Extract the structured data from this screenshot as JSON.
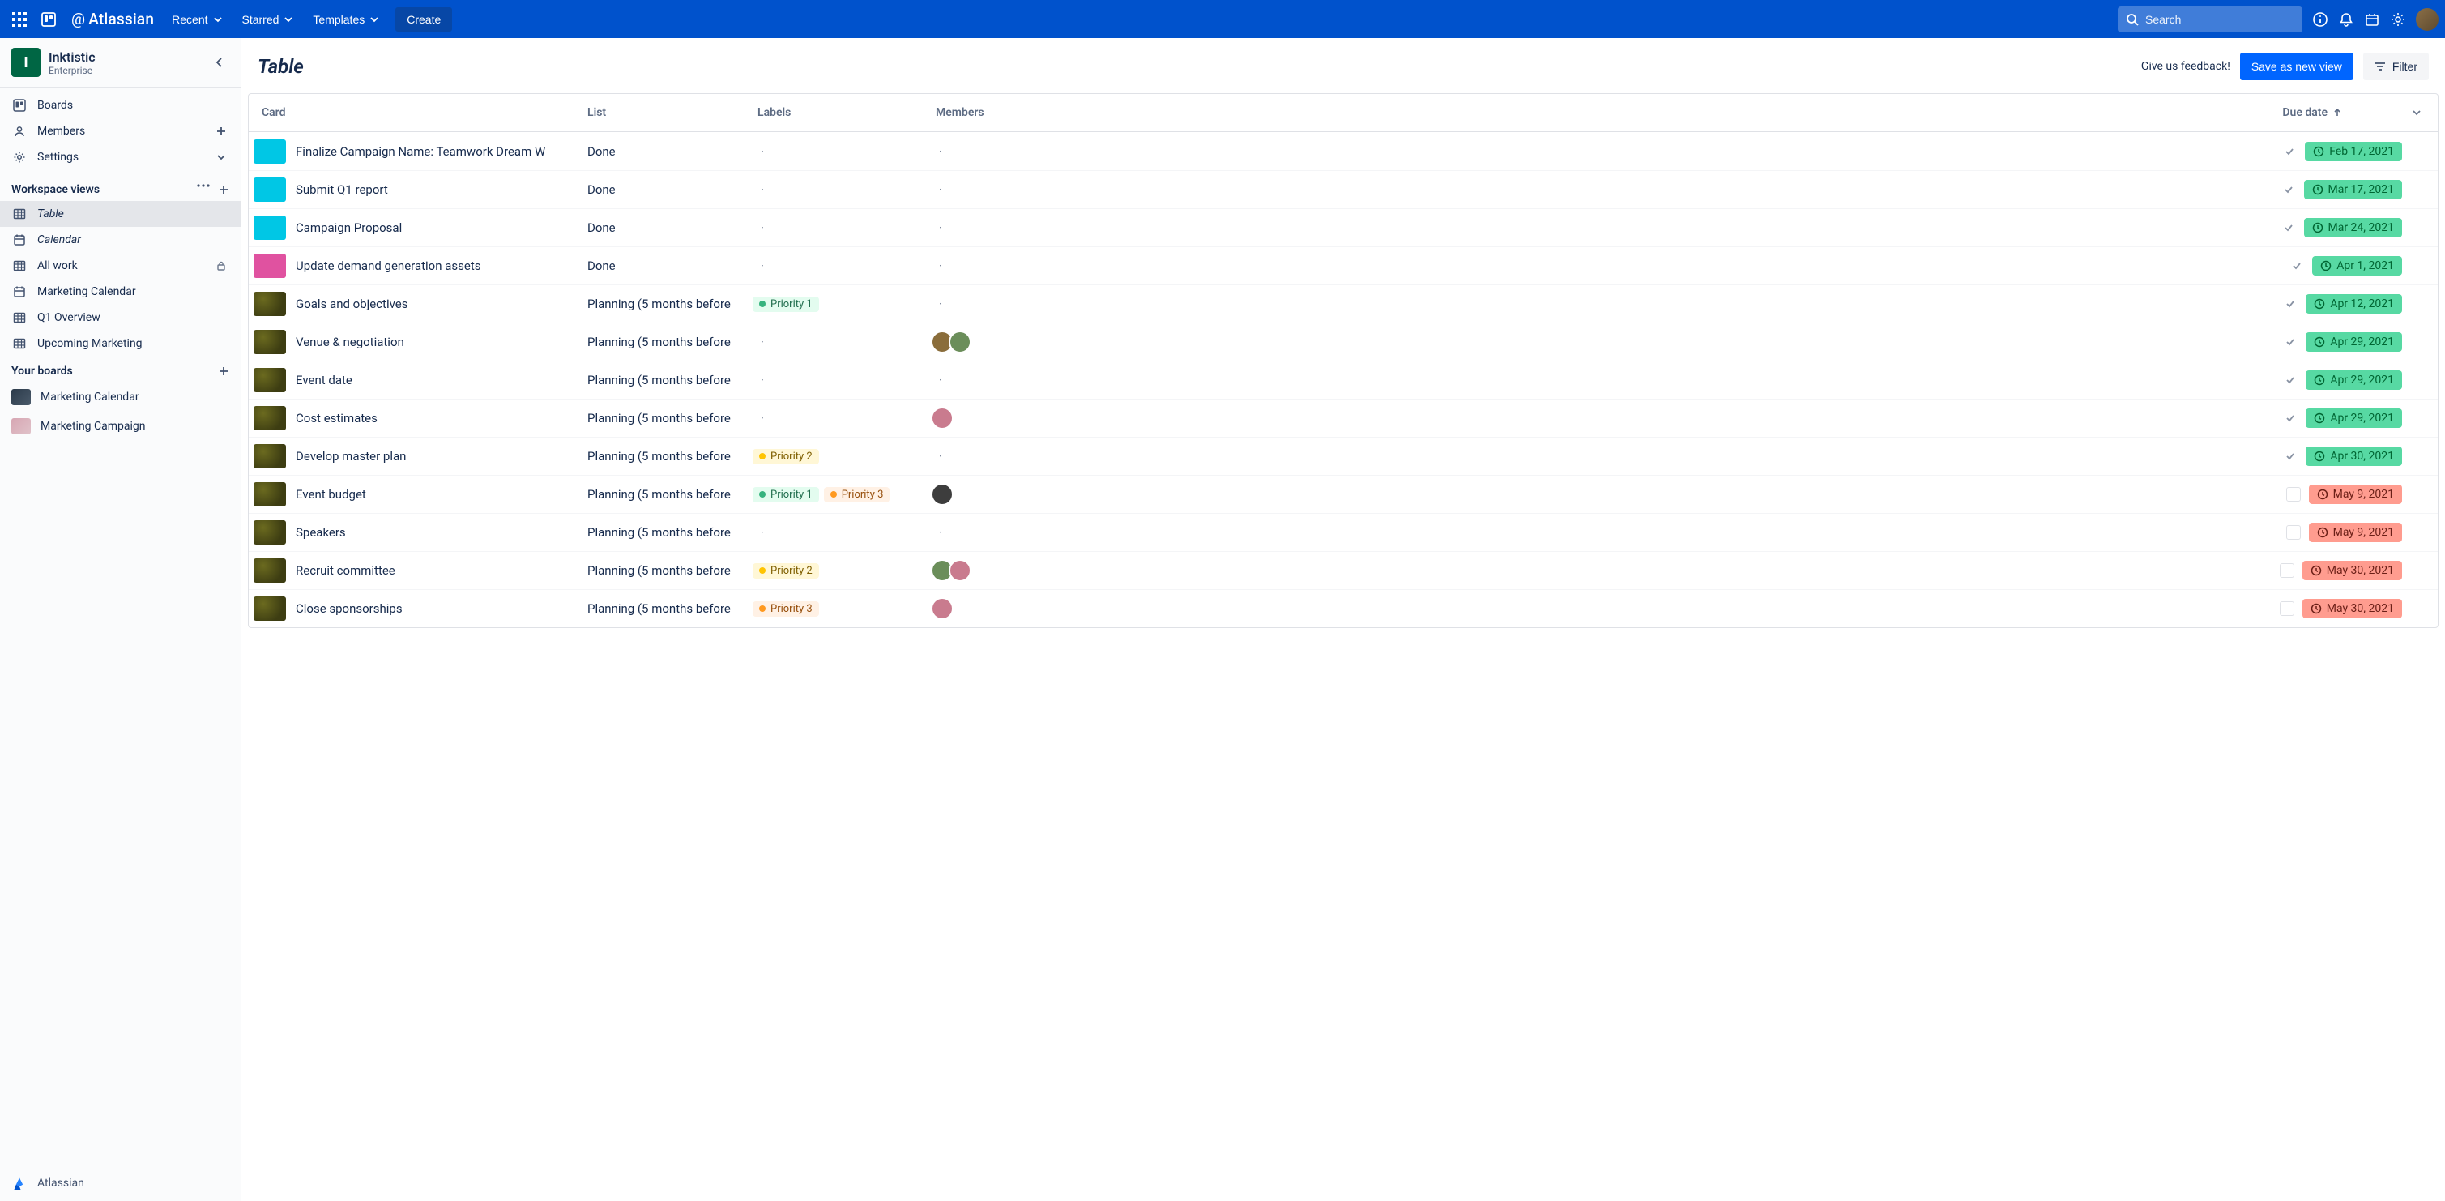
{
  "topnav": {
    "brand": "Atlassian",
    "menus": {
      "recent": "Recent",
      "starred": "Starred",
      "templates": "Templates"
    },
    "create": "Create",
    "search_placeholder": "Search"
  },
  "workspace": {
    "initial": "I",
    "name": "Inktistic",
    "tier": "Enterprise"
  },
  "sidebar": {
    "primary": {
      "boards": "Boards",
      "members": "Members",
      "settings": "Settings"
    },
    "views_heading": "Workspace views",
    "views": [
      {
        "label": "Table",
        "icon": "table",
        "italic": true,
        "active": true
      },
      {
        "label": "Calendar",
        "icon": "calendar",
        "italic": true
      },
      {
        "label": "All work",
        "icon": "table",
        "locked": true
      },
      {
        "label": "Marketing Calendar",
        "icon": "calendar"
      },
      {
        "label": "Q1 Overview",
        "icon": "table"
      },
      {
        "label": "Upcoming Marketing",
        "icon": "table"
      }
    ],
    "boards_heading": "Your boards",
    "boards": [
      {
        "label": "Marketing Calendar",
        "thumb": "dark"
      },
      {
        "label": "Marketing Campaign",
        "thumb": "pink"
      }
    ],
    "footer": "Atlassian"
  },
  "page": {
    "title": "Table",
    "feedback": "Give us feedback!",
    "save": "Save as new view",
    "filter": "Filter"
  },
  "table": {
    "columns": {
      "card": "Card",
      "list": "List",
      "labels": "Labels",
      "members": "Members",
      "due": "Due date"
    },
    "rows": [
      {
        "cover": "cyan",
        "title": "Finalize Campaign Name: Teamwork Dream W",
        "list": "Done",
        "labels": [],
        "members": 0,
        "due": "Feb 17, 2021",
        "due_color": "green",
        "checked": true
      },
      {
        "cover": "cyan",
        "title": "Submit Q1 report",
        "list": "Done",
        "labels": [],
        "members": 0,
        "due": "Mar 17, 2021",
        "due_color": "green",
        "checked": true
      },
      {
        "cover": "cyan",
        "title": "Campaign Proposal",
        "list": "Done",
        "labels": [],
        "members": 0,
        "due": "Mar 24, 2021",
        "due_color": "green",
        "checked": true
      },
      {
        "cover": "pink",
        "title": "Update demand generation assets",
        "list": "Done",
        "labels": [],
        "members": 0,
        "due": "Apr 1, 2021",
        "due_color": "green",
        "checked": true
      },
      {
        "cover": "tex",
        "title": "Goals and objectives",
        "list": "Planning (5 months before",
        "labels": [
          {
            "text": "Priority 1",
            "color": "green"
          }
        ],
        "members": 0,
        "due": "Apr 12, 2021",
        "due_color": "green",
        "checked": true
      },
      {
        "cover": "tex",
        "title": "Venue & negotiation",
        "list": "Planning (5 months before",
        "labels": [],
        "members": 2,
        "due": "Apr 29, 2021",
        "due_color": "green",
        "checked": true
      },
      {
        "cover": "tex",
        "title": "Event date",
        "list": "Planning (5 months before",
        "labels": [],
        "members": 0,
        "due": "Apr 29, 2021",
        "due_color": "green",
        "checked": true
      },
      {
        "cover": "tex",
        "title": "Cost estimates",
        "list": "Planning (5 months before",
        "labels": [],
        "members": 1,
        "due": "Apr 29, 2021",
        "due_color": "green",
        "checked": true
      },
      {
        "cover": "tex",
        "title": "Develop master plan",
        "list": "Planning (5 months before",
        "labels": [
          {
            "text": "Priority 2",
            "color": "yellow"
          }
        ],
        "members": 0,
        "due": "Apr 30, 2021",
        "due_color": "green",
        "checked": true
      },
      {
        "cover": "tex",
        "title": "Event budget",
        "list": "Planning (5 months before",
        "labels": [
          {
            "text": "Priority 1",
            "color": "green"
          },
          {
            "text": "Priority 3",
            "color": "orange"
          }
        ],
        "members": 1,
        "due": "May 9, 2021",
        "due_color": "red",
        "checked": false
      },
      {
        "cover": "tex",
        "title": "Speakers",
        "list": "Planning (5 months before",
        "labels": [],
        "members": 0,
        "due": "May 9, 2021",
        "due_color": "red",
        "checked": false
      },
      {
        "cover": "tex",
        "title": "Recruit committee",
        "list": "Planning (5 months before",
        "labels": [
          {
            "text": "Priority 2",
            "color": "yellow"
          }
        ],
        "members": 2,
        "due": "May 30, 2021",
        "due_color": "red",
        "checked": false
      },
      {
        "cover": "tex",
        "title": "Close sponsorships",
        "list": "Planning (5 months before",
        "labels": [
          {
            "text": "Priority 3",
            "color": "orange"
          }
        ],
        "members": 1,
        "due": "May 30, 2021",
        "due_color": "red",
        "checked": false
      }
    ]
  }
}
